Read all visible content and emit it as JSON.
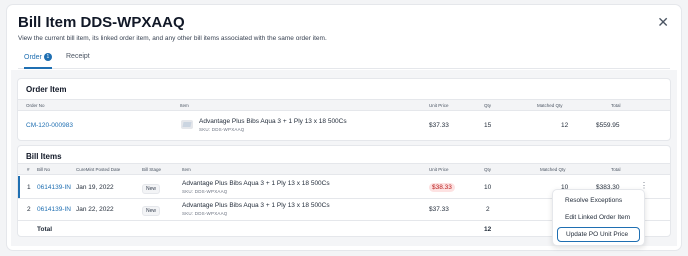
{
  "modal": {
    "title": "Bill Item DDS-WPXAAQ",
    "description": "View the current bill item, its linked order item, and any other bill items associated with the same order item."
  },
  "tabs": [
    {
      "label": "Order",
      "badge": "1",
      "active": true
    },
    {
      "label": "Receipt",
      "active": false
    }
  ],
  "order_item": {
    "title": "Order Item",
    "headers": {
      "order_no": "Order No",
      "item": "Item",
      "unit_price": "Unit Price",
      "qty": "Qty",
      "matched_qty": "Matched Qty",
      "total": "Total"
    },
    "row": {
      "order_no": "CM-120-000983",
      "item_name": "Advantage Plus Bibs Aqua 3 + 1 Ply 13 x 18 500Cs",
      "sku": "SKU: DDS-WPXAAQ",
      "unit_price": "$37.33",
      "qty": "15",
      "matched_qty": "12",
      "total": "$559.95"
    }
  },
  "bill_items": {
    "title": "Bill Items",
    "headers": {
      "num": "#",
      "bill_no": "Bill No",
      "posted_date": "CureMint Posted Date",
      "bill_stage": "Bill Stage",
      "item": "Item",
      "unit_price": "Unit Price",
      "qty": "Qty",
      "matched_qty": "Matched Qty",
      "total": "Total"
    },
    "rows": [
      {
        "num": "1",
        "bill_no": "0614139-IN",
        "posted_date": "Jan 19, 2022",
        "stage": "New",
        "item_name": "Advantage Plus Bibs Aqua 3 + 1 Ply 13 x 18 500Cs",
        "sku": "SKU: DDS-WPXAAQ",
        "unit_price": "$38.33",
        "qty": "10",
        "matched_qty": "10",
        "total": "$383.30"
      },
      {
        "num": "2",
        "bill_no": "0614139-IN",
        "posted_date": "Jan 22, 2022",
        "stage": "New",
        "item_name": "Advantage Plus Bibs Aqua 3 + 1 Ply 13 x 18 500Cs",
        "sku": "SKU: DDS-WPXAAQ",
        "unit_price": "$37.33",
        "qty": "2"
      }
    ],
    "total_label": "Total",
    "total_qty": "12"
  },
  "context_menu": {
    "items": [
      "Resolve Exceptions",
      "Edit Linked Order Item",
      "Update PO Unit Price"
    ]
  },
  "colors": {
    "accent": "#1f6fb2",
    "mismatch_bg": "#fde2e2",
    "mismatch_text": "#b91c1c"
  }
}
